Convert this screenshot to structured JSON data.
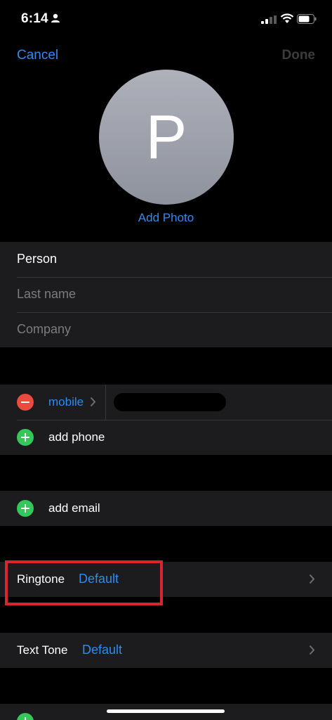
{
  "status_bar": {
    "time": "6:14"
  },
  "nav": {
    "cancel": "Cancel",
    "done": "Done"
  },
  "avatar": {
    "initial": "P",
    "add_photo": "Add Photo"
  },
  "name_fields": {
    "first_name": "Person",
    "last_name_placeholder": "Last name",
    "company_placeholder": "Company"
  },
  "phone": {
    "label": "mobile",
    "add_phone": "add phone"
  },
  "email": {
    "add_email": "add email"
  },
  "ringtone": {
    "label": "Ringtone",
    "value": "Default"
  },
  "text_tone": {
    "label": "Text Tone",
    "value": "Default"
  },
  "colors": {
    "accent": "#2f8bf0",
    "minus": "#eb4a3e",
    "plus": "#34c759",
    "highlight": "#d7262e"
  }
}
